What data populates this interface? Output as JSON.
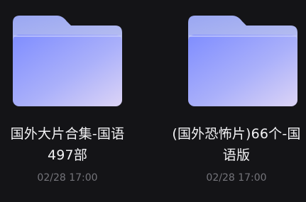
{
  "colors": {
    "background": "#141417",
    "name_text": "#f2f2f4",
    "date_text": "#74747a",
    "folder_back": "#a6b2f0",
    "folder_front_start": "#8593ff",
    "folder_front_end": "#d8d2f6"
  },
  "files": [
    {
      "icon": "folder-icon",
      "name": "国外大片合集-国语497部",
      "date": "02/28 17:00"
    },
    {
      "icon": "folder-icon",
      "name": "(国外恐怖片)66个-国语版",
      "date": "02/28 17:00"
    }
  ]
}
